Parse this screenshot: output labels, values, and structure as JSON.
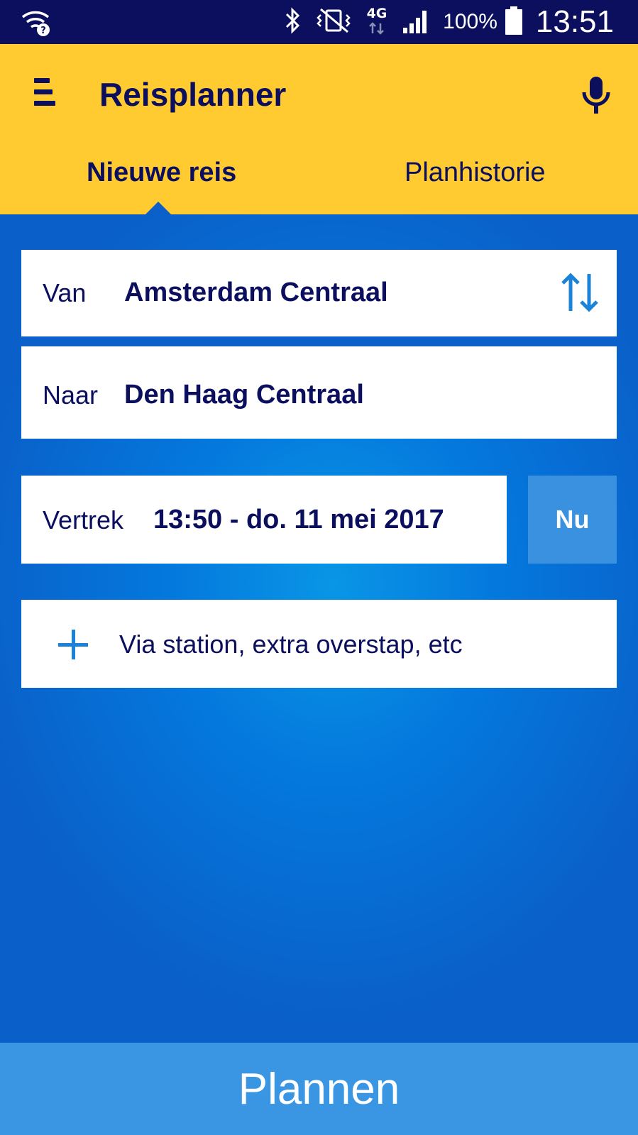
{
  "status_bar": {
    "battery_text": "100%",
    "time": "13:51",
    "network_label": "4G",
    "icons": [
      "wifi-question-icon",
      "bluetooth-icon",
      "vibrate-icon",
      "network-4g-icon",
      "signal-icon",
      "battery-icon"
    ]
  },
  "app_bar": {
    "title": "Reisplanner",
    "background_color": "#ffcb31",
    "text_color": "#0b0f5e",
    "menu_icon": "menu-icon",
    "mic_icon": "microphone-icon"
  },
  "tabs": [
    {
      "label": "Nieuwe reis",
      "selected": true
    },
    {
      "label": "Planhistorie",
      "selected": false
    }
  ],
  "from": {
    "label": "Van",
    "value": "Amsterdam Centraal"
  },
  "to": {
    "label": "Naar",
    "value": "Den Haag Centraal"
  },
  "swap_icon": "swap-vertical-icon",
  "departure": {
    "label": "Vertrek",
    "value": "13:50 - do. 11 mei 2017"
  },
  "now_button": {
    "label": "Nu"
  },
  "via": {
    "label": "Via station, extra overstap, etc",
    "icon": "plus-icon"
  },
  "plan_button": {
    "label": "Plannen"
  },
  "colors": {
    "accent_blue": "#1a82d8",
    "button_blue": "#3a95e2",
    "background_blue": "#0a5fc8"
  }
}
